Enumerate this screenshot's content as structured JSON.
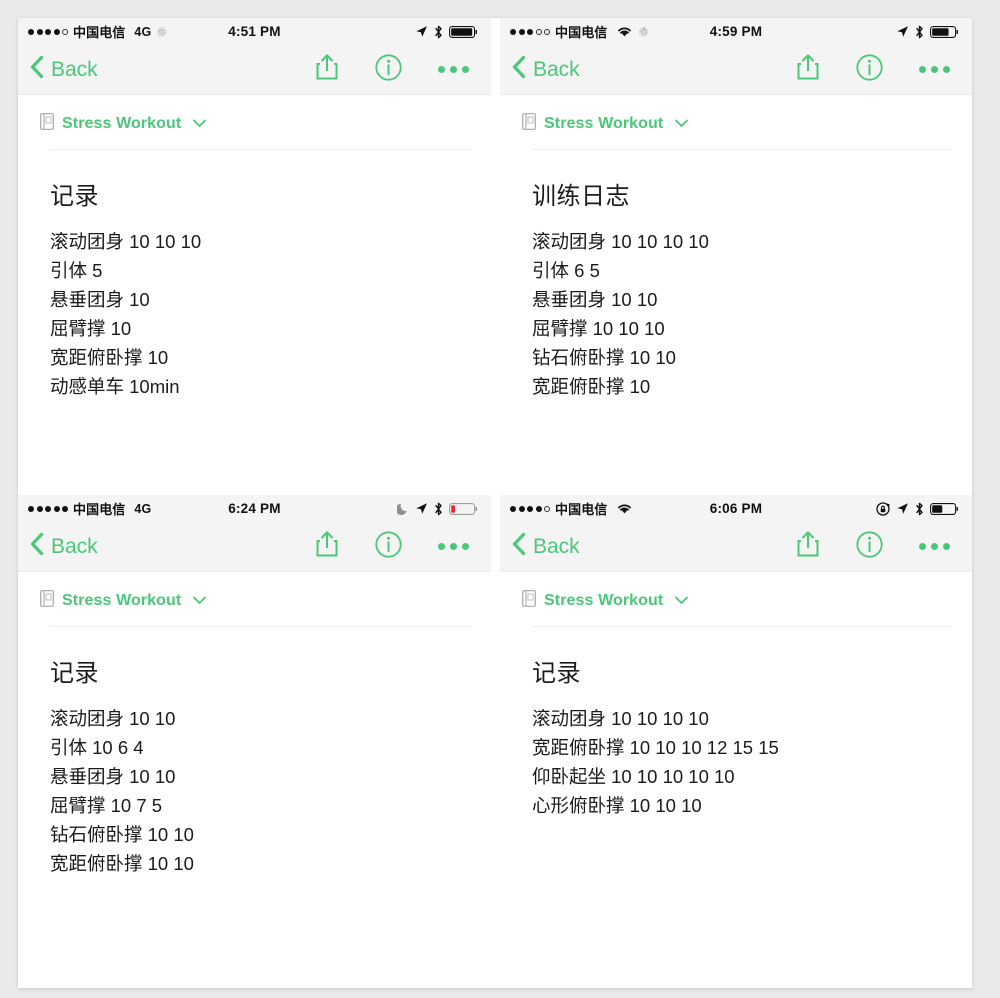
{
  "theme": {
    "accent": "#4ac778",
    "page_bg": "#e9e9e9",
    "sheet_bg": "#ffffff",
    "statusbar_bg": "#f4f4f4",
    "text": "#1b1b1b",
    "battery_low": "#e8262a"
  },
  "panels": [
    {
      "id": "panel-top-left",
      "status": {
        "signal_filled": 4,
        "signal_total": 5,
        "carrier": "中国电信",
        "network": "4G",
        "show_wifi": false,
        "show_spinner": true,
        "time": "4:51 PM",
        "icons": [
          "location-arrow-icon",
          "bluetooth-icon",
          "battery-icon"
        ],
        "battery_level": 100,
        "battery_low": false,
        "show_moon": false,
        "show_rotation_lock": false
      },
      "nav": {
        "back_label": "Back",
        "actions": [
          "share-icon",
          "info-icon",
          "more-icon"
        ]
      },
      "doc": {
        "icon": "notebook-icon",
        "title": "Stress Workout",
        "chevron": "chevron-down-icon"
      },
      "body": {
        "heading": "记录",
        "lines": [
          "滚动团身 10 10 10",
          "引体 5",
          "悬垂团身 10",
          "屈臂撑 10",
          "宽距俯卧撑 10",
          "动感单车 10min"
        ]
      }
    },
    {
      "id": "panel-top-right",
      "status": {
        "signal_filled": 3,
        "signal_total": 5,
        "carrier": "中国电信",
        "network": "",
        "show_wifi": true,
        "show_spinner": true,
        "time": "4:59 PM",
        "icons": [
          "location-arrow-icon",
          "bluetooth-icon",
          "battery-icon"
        ],
        "battery_level": 78,
        "battery_low": false,
        "show_moon": false,
        "show_rotation_lock": false
      },
      "nav": {
        "back_label": "Back",
        "actions": [
          "share-icon",
          "info-icon",
          "more-icon"
        ]
      },
      "doc": {
        "icon": "notebook-icon",
        "title": "Stress Workout",
        "chevron": "chevron-down-icon"
      },
      "body": {
        "heading": "训练日志",
        "lines": [
          "滚动团身 10 10 10 10",
          "引体 6 5",
          "悬垂团身 10 10",
          "屈臂撑 10 10 10",
          "钻石俯卧撑 10 10",
          "宽距俯卧撑 10"
        ]
      }
    },
    {
      "id": "panel-bottom-left",
      "status": {
        "signal_filled": 5,
        "signal_total": 5,
        "carrier": "中国电信",
        "network": "4G",
        "show_wifi": false,
        "show_spinner": false,
        "time": "6:24 PM",
        "icons": [
          "moon-icon",
          "location-arrow-icon",
          "bluetooth-icon",
          "battery-icon"
        ],
        "battery_level": 18,
        "battery_low": true,
        "show_moon": true,
        "show_rotation_lock": false
      },
      "nav": {
        "back_label": "Back",
        "actions": [
          "share-icon",
          "info-icon",
          "more-icon"
        ]
      },
      "doc": {
        "icon": "notebook-icon",
        "title": "Stress Workout",
        "chevron": "chevron-down-icon"
      },
      "body": {
        "heading": "记录",
        "lines": [
          "滚动团身 10 10",
          "引体 10 6 4",
          "悬垂团身 10 10",
          "屈臂撑 10 7 5",
          "钻石俯卧撑 10 10",
          "宽距俯卧撑 10 10"
        ]
      }
    },
    {
      "id": "panel-bottom-right",
      "status": {
        "signal_filled": 4,
        "signal_total": 5,
        "carrier": "中国电信",
        "network": "",
        "show_wifi": true,
        "show_spinner": false,
        "time": "6:06 PM",
        "icons": [
          "rotation-lock-icon",
          "location-arrow-icon",
          "bluetooth-icon",
          "battery-icon"
        ],
        "battery_level": 48,
        "battery_low": false,
        "show_moon": false,
        "show_rotation_lock": true
      },
      "nav": {
        "back_label": "Back",
        "actions": [
          "share-icon",
          "info-icon",
          "more-icon"
        ]
      },
      "doc": {
        "icon": "notebook-icon",
        "title": "Stress Workout",
        "chevron": "chevron-down-icon"
      },
      "body": {
        "heading": "记录",
        "lines": [
          "滚动团身 10 10 10 10",
          "宽距俯卧撑 10 10 10 12 15 15",
          "仰卧起坐 10 10 10 10 10",
          "心形俯卧撑 10 10 10"
        ]
      }
    }
  ]
}
